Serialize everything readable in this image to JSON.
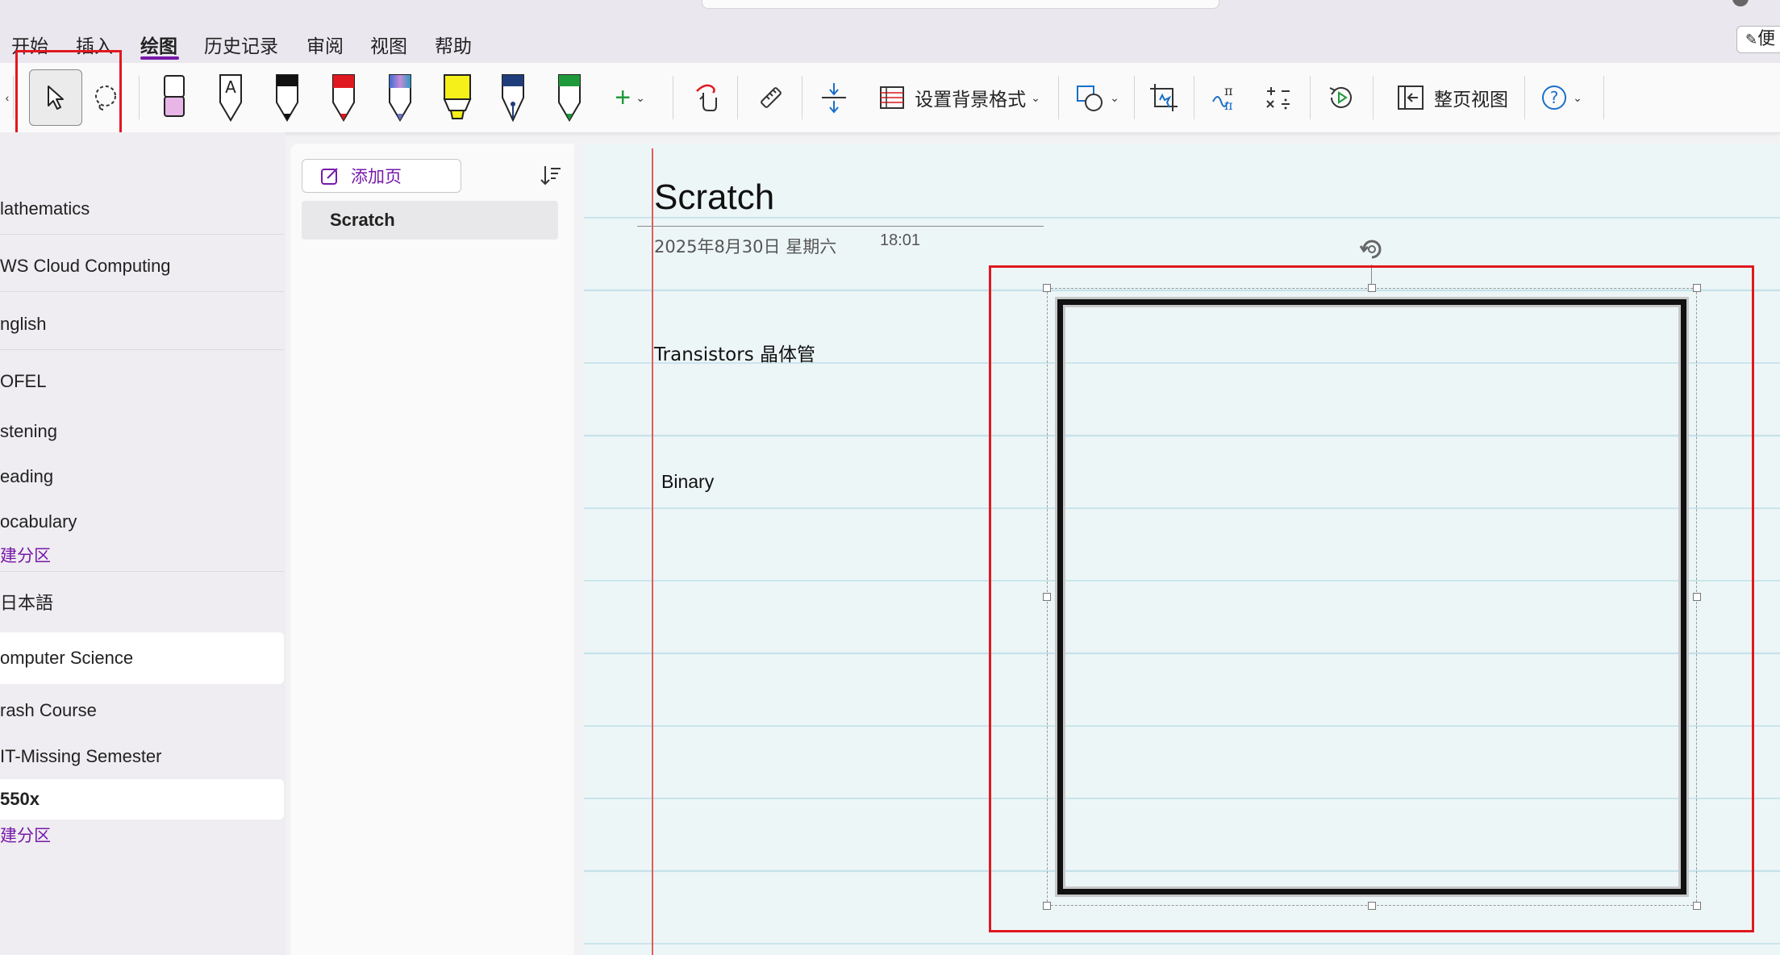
{
  "menu": {
    "tabs": [
      "开始",
      "插入",
      "绘图",
      "历史记录",
      "审阅",
      "视图",
      "帮助"
    ],
    "active_tab": "绘图",
    "sticky_notes_label": "便"
  },
  "ribbon": {
    "background_label": "设置背景格式",
    "fullpage_label": "整页视图",
    "pens": [
      {
        "name": "eraser",
        "color": "#e7b6e6"
      },
      {
        "name": "text-pen",
        "color": "#ffffff"
      },
      {
        "name": "black-pen",
        "color": "#111111"
      },
      {
        "name": "red-pen",
        "color": "#e0181f"
      },
      {
        "name": "galaxy-pen",
        "color": "#6a74c9"
      },
      {
        "name": "yellow-highlighter",
        "color": "#f5ef1a"
      },
      {
        "name": "navy-fountain-pen",
        "color": "#1f3d7a"
      },
      {
        "name": "green-pen",
        "color": "#1f9a3a"
      }
    ]
  },
  "sections": [
    {
      "label": "lathematics"
    },
    {
      "label": "WS Cloud Computing"
    },
    {
      "label": "nglish"
    },
    {
      "label": "OFEL"
    },
    {
      "label": "stening"
    },
    {
      "label": "eading"
    },
    {
      "label": "ocabulary"
    },
    {
      "label": "建分区"
    },
    {
      "label": "日本語"
    },
    {
      "label": "omputer Science"
    },
    {
      "label": "rash Course"
    },
    {
      "label": "IT-Missing Semester"
    },
    {
      "label": "550x"
    },
    {
      "label": "建分区"
    }
  ],
  "pages": {
    "add_label": "添加页",
    "items": [
      "Scratch"
    ]
  },
  "note": {
    "title": "Scratch",
    "date": "2025年8月30日 星期六",
    "time": "18:01",
    "lines": [
      "Transistors 晶体管",
      "Binary"
    ]
  },
  "colors": {
    "accent": "#7719aa",
    "highlight": "#e0181f",
    "canvas": "#edf6f7",
    "rule": "#c6e2ea",
    "margin": "#e45a5a"
  }
}
